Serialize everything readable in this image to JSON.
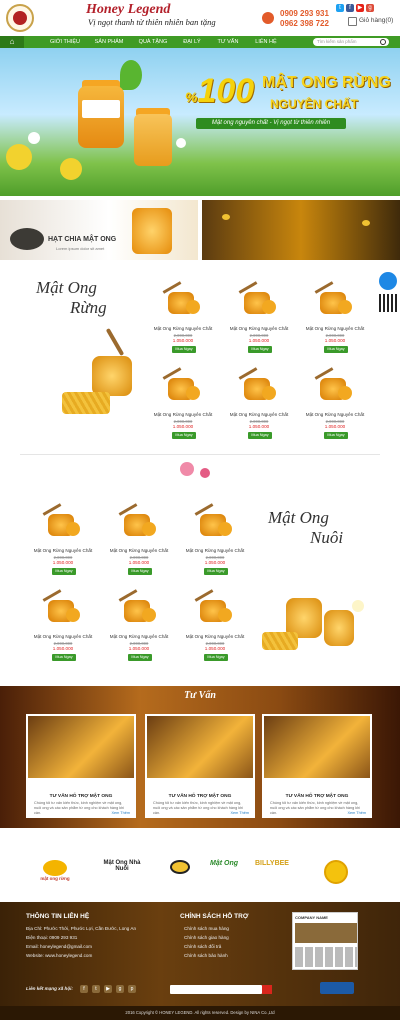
{
  "colors": {
    "brand_green": "#3f9b25",
    "price_red": "#e02020",
    "brand_red": "#b3202a",
    "honey_gold": "#f5d20b"
  },
  "header": {
    "brand": "Honey Legend",
    "slogan": "Vị ngọt thanh từ thiên nhiên ban tặng",
    "phone1": "0909 293 931",
    "phone2": "0962 398 722",
    "cart_label": "Giỏ hàng(0)",
    "social_icons": [
      "twitter-icon",
      "facebook-icon",
      "youtube-icon",
      "google-plus-icon"
    ]
  },
  "nav": {
    "home_icon": "home-icon",
    "items": [
      "GIỚI THIỆU",
      "SẢN PHẨM",
      "QUÀ TẶNG",
      "ĐẠI LÝ",
      "TƯ VẤN",
      "LIÊN HỆ"
    ],
    "search_placeholder": "Tìm kiếm sản phẩm"
  },
  "banner": {
    "percent": "%",
    "number": "100",
    "title1": "MẬT ONG RỪNG",
    "title2": "NGUYÊN CHẤT",
    "tagline": "Mật ong nguyên chất - Vị ngọt từ thiên nhiên"
  },
  "promos": [
    {
      "label": "HẠT CHIA MẬT ONG",
      "sub": "Lorem ipsum dolor sit amet"
    },
    {
      "label": "",
      "sub": ""
    }
  ],
  "section1": {
    "title_line1": "Mật Ong",
    "title_line2": "Rừng",
    "products": [
      {
        "name": "Mật Ong Rừng Nguyên Chất",
        "old_price": "2,000,000",
        "price": "1.050.000",
        "button": "Mua Ngay"
      },
      {
        "name": "Mật Ong Rừng Nguyên Chất",
        "old_price": "2,000,000",
        "price": "1.050.000",
        "button": "Mua Ngay"
      },
      {
        "name": "Mật Ong Rừng Nguyên Chất",
        "old_price": "2,000,000",
        "price": "1.050.000",
        "button": "Mua Ngay"
      },
      {
        "name": "Mật Ong Rừng Nguyên Chất",
        "old_price": "2,000,000",
        "price": "1.050.000",
        "button": "Mua Ngay"
      },
      {
        "name": "Mật Ong Rừng Nguyên Chất",
        "old_price": "2,000,000",
        "price": "1.050.000",
        "button": "Mua Ngay"
      },
      {
        "name": "Mật Ong Rừng Nguyên Chất",
        "old_price": "2,000,000",
        "price": "1.050.000",
        "button": "Mua Ngay"
      }
    ]
  },
  "section2": {
    "title_line1": "Mật Ong",
    "title_line2": "Nuôi",
    "products": [
      {
        "name": "Mật Ong Rừng Nguyên Chất",
        "old_price": "2,000,000",
        "price": "1.050.000",
        "button": "Mua Ngay"
      },
      {
        "name": "Mật Ong Rừng Nguyên Chất",
        "old_price": "2,000,000",
        "price": "1.050.000",
        "button": "Mua Ngay"
      },
      {
        "name": "Mật Ong Rừng Nguyên Chất",
        "old_price": "2,000,000",
        "price": "1.050.000",
        "button": "Mua Ngay"
      },
      {
        "name": "Mật Ong Rừng Nguyên Chất",
        "old_price": "2,000,000",
        "price": "1.050.000",
        "button": "Mua Ngay"
      },
      {
        "name": "Mật Ong Rừng Nguyên Chất",
        "old_price": "2,000,000",
        "price": "1.050.000",
        "button": "Mua Ngay"
      },
      {
        "name": "Mật Ong Rừng Nguyên Chất",
        "old_price": "2,000,000",
        "price": "1.050.000",
        "button": "Mua Ngay"
      }
    ]
  },
  "tuvan": {
    "title": "Tư Vấn",
    "cards": [
      {
        "title": "TƯ VẤN HỖ TRỢ MẬT ONG",
        "text": "Chúng tôi tư vấn kiến thức, kinh nghiệm về mật ong, nuôi ong và các sản phẩm từ ong cho khách hàng khi cần.",
        "more": "Xem Thêm"
      },
      {
        "title": "TƯ VẤN HỖ TRỢ MẬT ONG",
        "text": "Chúng tôi tư vấn kiến thức, kinh nghiệm về mật ong, nuôi ong và các sản phẩm từ ong cho khách hàng khi cần.",
        "more": "Xem Thêm"
      },
      {
        "title": "TƯ VẤN HỖ TRỢ MẬT ONG",
        "text": "Chúng tôi tư vấn kiến thức, kinh nghiệm về mật ong, nuôi ong và các sản phẩm từ ong cho khách hàng khi cần.",
        "more": "Xem Thêm"
      }
    ]
  },
  "partners": [
    "mật ong rừng",
    "Mật Ong Nhà Nuôi",
    "",
    "Mật Ong",
    "BILLYBEE",
    ""
  ],
  "footer": {
    "contact_title": "THÔNG TIN LIÊN HỆ",
    "contact_lines": [
      "Địa Chỉ: Phước Thới, Phước Lợi, Cần Đước, Long An",
      "Điện thoại: 0909 293 931",
      "Email: honeylegend@gmail.com",
      "Website: www.honeylegend.com"
    ],
    "policy_title": "CHÍNH SÁCH HỖ TRỢ",
    "policy_items": [
      "Chính sách mua hàng",
      "Chính sách giao hàng",
      "Chính sách đổi trả",
      "Chính sách bảo hành"
    ],
    "social_label": "Liên kết mạng xã hội:",
    "fanbox_title": "COMPANY NAME",
    "copyright": "2016 Copyright © HONEY LEGEND. All rights reserved. Design by NINA Co.,Ltd"
  }
}
